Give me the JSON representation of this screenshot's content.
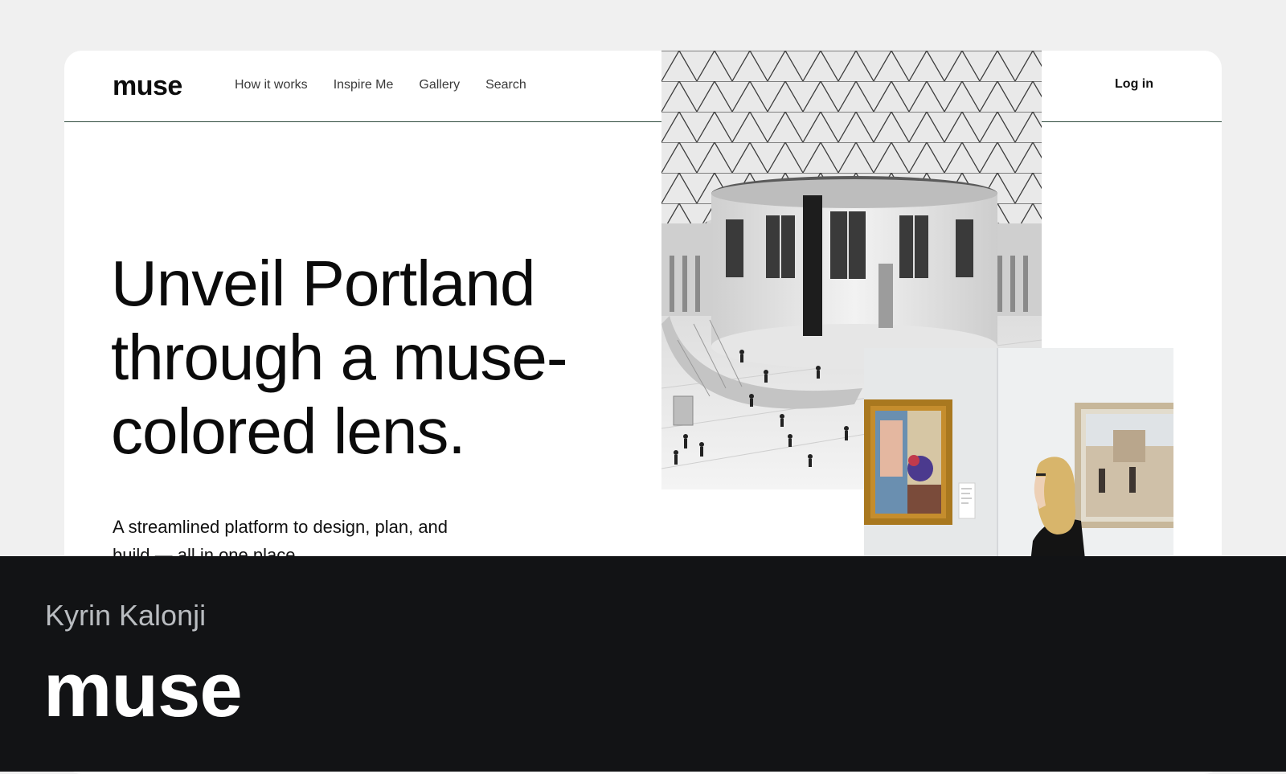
{
  "site": {
    "logo": "muse",
    "nav": [
      "How it works",
      "Inspire Me",
      "Gallery",
      "Search"
    ],
    "login_label": "Log in"
  },
  "hero": {
    "headline": "Unveil Portland through a muse-colored lens.",
    "subtext": "A streamlined platform to design, plan, and build — all in one place."
  },
  "images": {
    "primary": "museum-atrium-photo",
    "secondary": "gallery-visitor-photo"
  },
  "footer": {
    "author": "Kyrin Kalonji",
    "brand": "muse"
  },
  "colors": {
    "page_bg": "#f0f0f0",
    "frame_bg": "#ffffff",
    "nav_line": "#2e4a3c",
    "footer_bg": "#121315",
    "author_text": "#b9bcc0",
    "brand_text": "#ffffff"
  }
}
